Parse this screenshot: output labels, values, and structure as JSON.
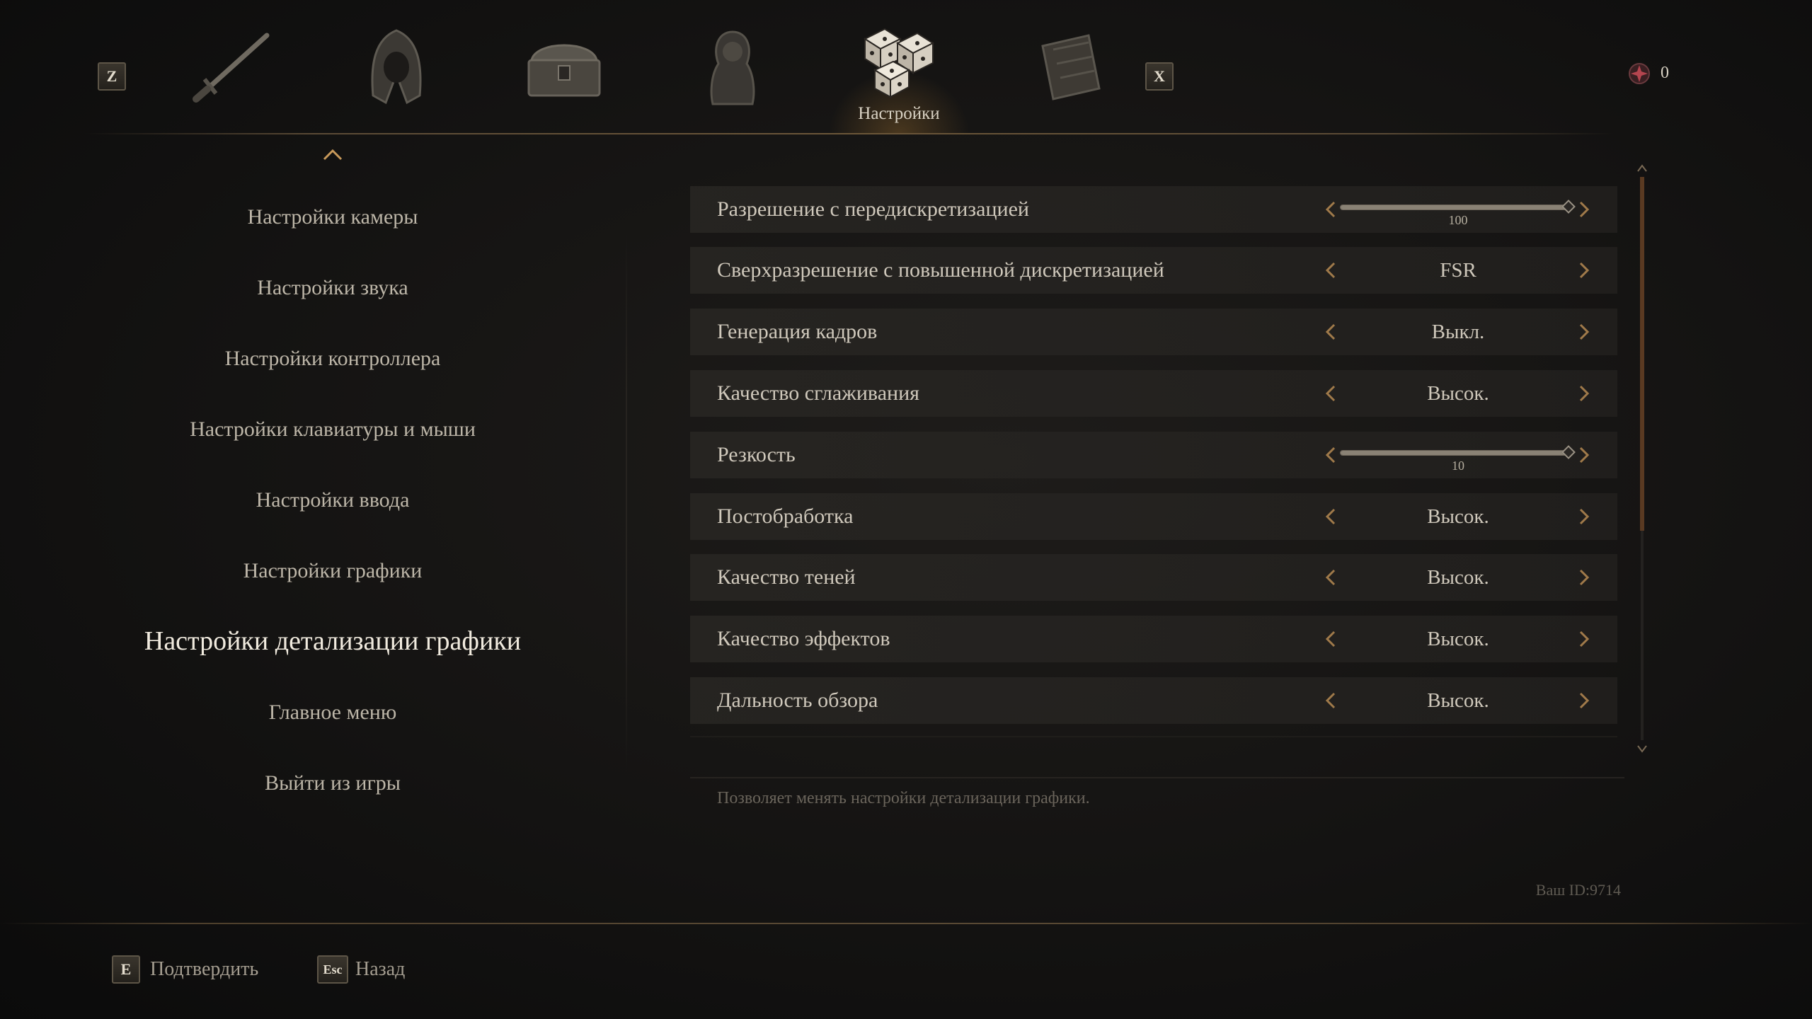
{
  "nav": {
    "prev_key": "Z",
    "next_key": "X",
    "tabs": [
      {
        "icon": "sword-icon"
      },
      {
        "icon": "hood-icon"
      },
      {
        "icon": "chest-icon"
      },
      {
        "icon": "character-icon"
      },
      {
        "icon": "dice-icon",
        "label": "Настройки",
        "active": true
      },
      {
        "icon": "book-icon"
      }
    ],
    "currency_icon": "gem-icon",
    "currency_value": "0"
  },
  "menu": {
    "items": [
      {
        "label": "Настройки камеры"
      },
      {
        "label": "Настройки звука"
      },
      {
        "label": "Настройки контроллера"
      },
      {
        "label": "Настройки клавиатуры и мыши"
      },
      {
        "label": "Настройки ввода"
      },
      {
        "label": "Настройки графики"
      },
      {
        "label": "Настройки детализации графики",
        "active": true
      },
      {
        "label": "Главное меню"
      },
      {
        "label": "Выйти из игры"
      }
    ]
  },
  "settings": [
    {
      "label": "Разрешение с передискретизацией",
      "type": "slider",
      "value": "100",
      "fill": 1.0
    },
    {
      "label": "Сверхразрешение с повышенной дискретизацией",
      "type": "select",
      "value": "FSR"
    },
    {
      "label": "Генерация кадров",
      "type": "select",
      "value": "Выкл."
    },
    {
      "label": "Качество сглаживания",
      "type": "select",
      "value": "Высок."
    },
    {
      "label": "Резкость",
      "type": "slider",
      "value": "10",
      "fill": 1.0
    },
    {
      "label": "Постобработка",
      "type": "select",
      "value": "Высок."
    },
    {
      "label": "Качество теней",
      "type": "select",
      "value": "Высок."
    },
    {
      "label": "Качество эффектов",
      "type": "select",
      "value": "Высок."
    },
    {
      "label": "Дальность обзора",
      "type": "select",
      "value": "Высок."
    }
  ],
  "description": "Позволяет менять настройки детализации графики.",
  "user_id": "Ваш ID:9714",
  "hints": {
    "confirm_key": "E",
    "confirm_label": "Подтвердить",
    "back_key": "Esc",
    "back_label": "Назад"
  },
  "colors": {
    "accent": "#c8995a",
    "arrow": "#a07a4a",
    "active_text": "#f1ebdf"
  }
}
